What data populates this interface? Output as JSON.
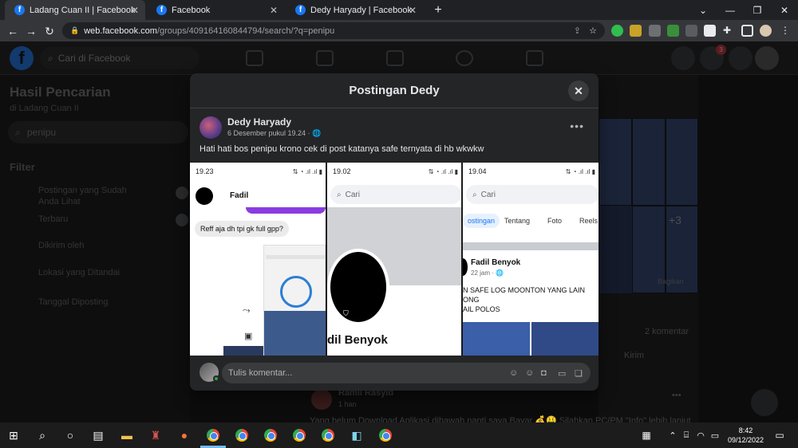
{
  "browser": {
    "tabs": [
      {
        "title": "Ladang Cuan II | Facebook",
        "active": true
      },
      {
        "title": "Facebook",
        "active": false
      },
      {
        "title": "Dedy Haryady | Facebook",
        "active": false
      }
    ],
    "url_host": "web.facebook.com",
    "url_path": "/groups/409164160844794/search/?q=penipu"
  },
  "facebook": {
    "search_placeholder": "Cari di Facebook",
    "notification_count": "3"
  },
  "left_panel": {
    "title": "Hasil Pencarian",
    "subtitle": "di Ladang Cuan II",
    "search_value": "penipu",
    "filter_label": "Filter",
    "filters": [
      "Postingan yang Sudah Anda Lihat",
      "Terbaru",
      "Dikirim oleh",
      "Lokasi yang Ditandai",
      "Tanggal Diposting"
    ]
  },
  "behind": {
    "plus_more": "+3",
    "comments_count": "2 komentar",
    "send_label": "Kirim",
    "share_label": "Bagikan",
    "commenter_name": "Ramli Rasyid",
    "commenter_time": "1 han",
    "comment_text": "Yang belum Download Aplikasi dibawah nanti saya Bayar 💰🤑 Silahkan PC/PM \"Info\" lebih lanjut"
  },
  "modal": {
    "title": "Postingan Dedy",
    "author": "Dedy Haryady",
    "date": "6 Desember pukul 19.24 · ",
    "text": "Hati hati bos penipu krono cek di post katanya safe ternyata di hb wkwkw",
    "comment_placeholder": "Tulis komentar...",
    "screens": [
      {
        "time": "19.23",
        "contact": "Fadil",
        "message": "Reff aja dh tpi gk full gpp?"
      },
      {
        "time": "19.02",
        "search": "Cari",
        "profile_name": "dil Benyok"
      },
      {
        "time": "19.04",
        "search": "Cari",
        "tabs": [
          "ostingan",
          "Tentang",
          "Foto",
          "Reels"
        ],
        "post_author": "Fadil Benyok",
        "post_time": "22 jam · ",
        "post_lines": [
          "N SAFE LOG MOONTON YANG LAIN",
          "ONG",
          "AIL POLOS"
        ]
      }
    ]
  },
  "taskbar": {
    "time": "8:42",
    "date": "09/12/2022"
  }
}
